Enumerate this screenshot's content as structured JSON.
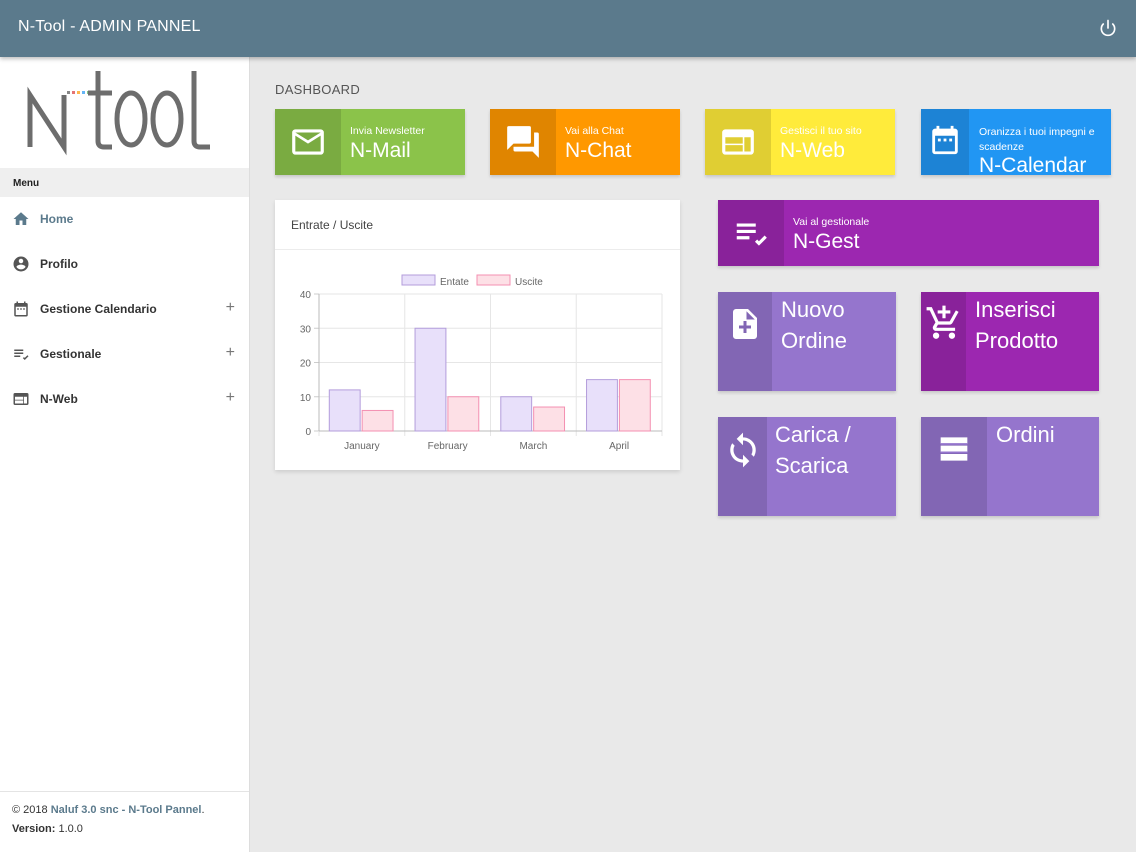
{
  "app": {
    "title": "N-Tool - ADMIN PANNEL"
  },
  "logo": {
    "text": "N-Tool"
  },
  "sidebar": {
    "menu_label": "Menu",
    "items": [
      {
        "label": "Home",
        "icon": "home-icon",
        "active": true,
        "expandable": false
      },
      {
        "label": "Profilo",
        "icon": "account-circle-icon",
        "active": false,
        "expandable": false
      },
      {
        "label": "Gestione Calendario",
        "icon": "calendar-icon",
        "active": false,
        "expandable": true
      },
      {
        "label": "Gestionale",
        "icon": "playlist-check-icon",
        "active": false,
        "expandable": true
      },
      {
        "label": "N-Web",
        "icon": "web-icon",
        "active": false,
        "expandable": true
      }
    ],
    "expand_symbol": "+"
  },
  "footer": {
    "copyright_prefix": "© 2018 ",
    "company": "Naluf 3.0 snc - N-Tool Pannel",
    "copyright_suffix": ".",
    "version_label": "Version:",
    "version_value": " 1.0.0"
  },
  "main": {
    "section_title": "DASHBOARD",
    "tiles": {
      "mail": {
        "subtitle": "Invia Newsletter",
        "title": "N-Mail",
        "color": "#8bc34a",
        "icon": "email-icon"
      },
      "chat": {
        "subtitle": "Vai alla Chat",
        "title": "N-Chat",
        "color": "#ff9800",
        "icon": "forum-icon"
      },
      "web": {
        "subtitle": "Gestisci il tuo sito",
        "title": "N-Web",
        "color": "#ffeb3b",
        "icon": "web-icon"
      },
      "calendar": {
        "subtitle": "Oranizza i tuoi impegni e scadenze",
        "title": "N-Calendar",
        "color": "#2196f3",
        "icon": "calendar-icon"
      },
      "gest": {
        "subtitle": "Vai al gestionale",
        "title": "N-Gest",
        "color": "#9c27b0",
        "icon": "playlist-check-icon"
      },
      "nuovo_ordine": {
        "line1": "Nuovo",
        "line2": "Ordine",
        "color": "#9575cd",
        "icon": "file-plus-icon"
      },
      "inserisci_prodotto": {
        "line1": "Inserisci",
        "line2": "Prodotto",
        "color": "#9c27b0",
        "icon": "cart-plus-icon"
      },
      "carica_scarica": {
        "line1": "Carica /",
        "line2": "Scarica",
        "color": "#9575cd",
        "icon": "sync-icon"
      },
      "ordini": {
        "line1": "Ordini",
        "color": "#9575cd",
        "icon": "list-icon"
      }
    },
    "chart_card": {
      "title": "Entrate / Uscite"
    }
  },
  "chart_data": {
    "type": "bar",
    "categories": [
      "January",
      "February",
      "March",
      "April"
    ],
    "series": [
      {
        "name": "Entate",
        "values": [
          12,
          30,
          10,
          15
        ],
        "fill": "#e8e0fa",
        "stroke": "#b39ddb"
      },
      {
        "name": "Uscite",
        "values": [
          6,
          10,
          7,
          15
        ],
        "fill": "#fde0e6",
        "stroke": "#f48fb1"
      }
    ],
    "ylim": [
      0,
      40
    ],
    "yticks": [
      0,
      10,
      20,
      30,
      40
    ],
    "legend": "top",
    "grid": true
  }
}
